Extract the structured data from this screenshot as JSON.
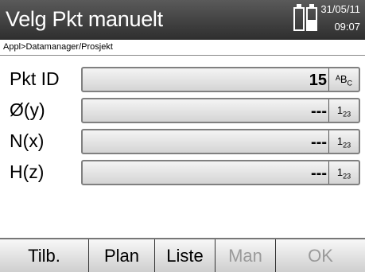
{
  "header": {
    "title": "Velg Pkt manuelt",
    "date": "31/05/11",
    "time": "09:07",
    "icons": [
      "battery-icon",
      "battery-icon"
    ]
  },
  "breadcrumb": "Appl>Datamanager/Prosjekt",
  "fields": [
    {
      "label": "Pkt ID",
      "value": "15",
      "unit": "ᴬBC"
    },
    {
      "label": "Ø(y)",
      "value": "---",
      "unit": "1₂₃"
    },
    {
      "label": "N(x)",
      "value": "---",
      "unit": "1₂₃"
    },
    {
      "label": "H(z)",
      "value": "---",
      "unit": "1₂₃"
    }
  ],
  "softkeys": [
    {
      "label": "Tilb.",
      "enabled": true
    },
    {
      "label": "Plan",
      "enabled": true
    },
    {
      "label": "Liste",
      "enabled": true
    },
    {
      "label": "Man",
      "enabled": false
    },
    {
      "label": "OK",
      "enabled": false
    }
  ],
  "colors": {
    "header_bg": "#3a3a3a",
    "disabled_text": "#9a9a9a"
  }
}
